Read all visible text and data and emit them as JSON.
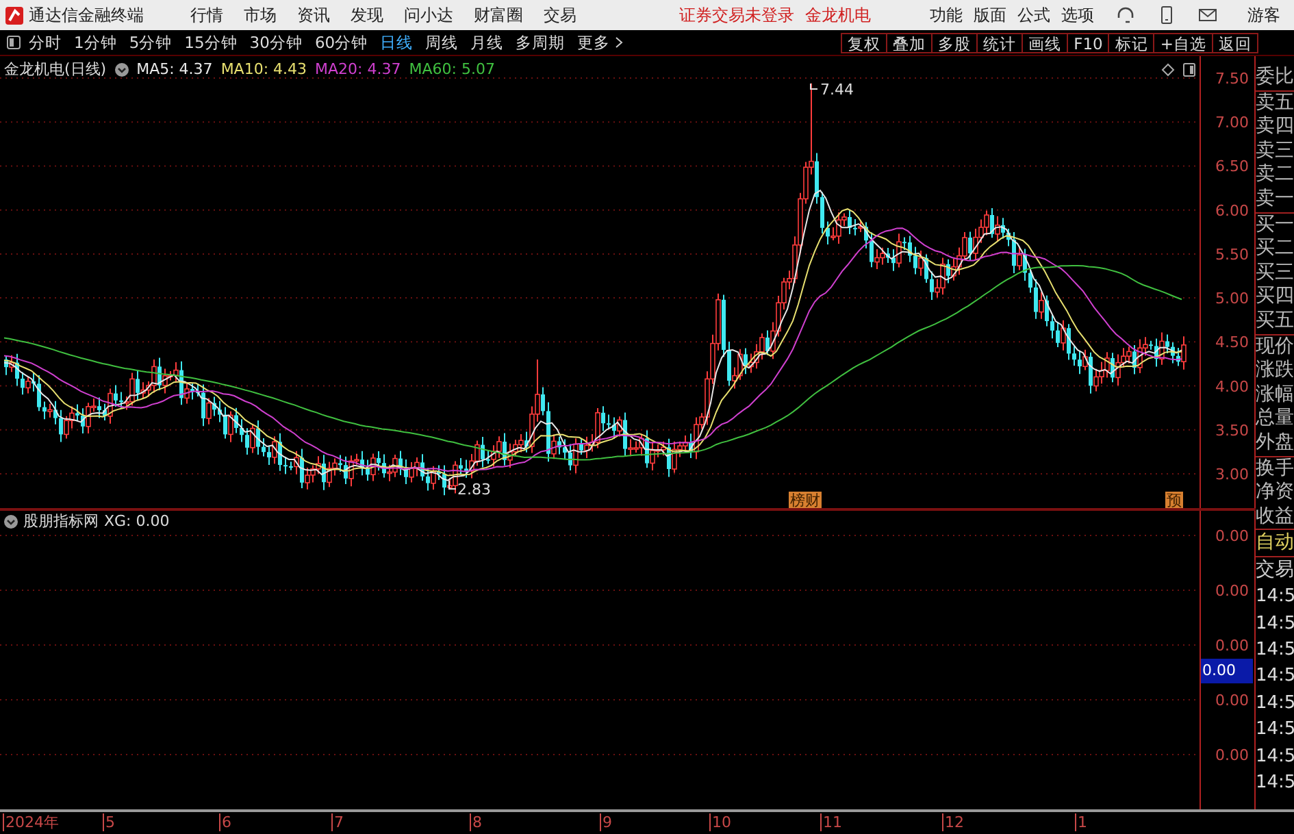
{
  "app": {
    "title": "通达信金融终端"
  },
  "menu": [
    "行情",
    "市场",
    "资讯",
    "发现",
    "问小达",
    "财富圈",
    "交易"
  ],
  "status": {
    "login": "证券交易未登录",
    "stock": "金龙机电"
  },
  "top_actions": [
    "功能",
    "版面",
    "公式",
    "选项"
  ],
  "user": "游客",
  "periods": [
    {
      "label": "分时",
      "selected": false
    },
    {
      "label": "1分钟",
      "selected": false
    },
    {
      "label": "5分钟",
      "selected": false
    },
    {
      "label": "15分钟",
      "selected": false
    },
    {
      "label": "30分钟",
      "selected": false
    },
    {
      "label": "60分钟",
      "selected": false
    },
    {
      "label": "日线",
      "selected": true
    },
    {
      "label": "周线",
      "selected": false
    },
    {
      "label": "月线",
      "selected": false
    },
    {
      "label": "多周期",
      "selected": false
    },
    {
      "label": "更多",
      "selected": false
    }
  ],
  "tools": [
    "复权",
    "叠加",
    "多股",
    "统计",
    "画线",
    "F10",
    "标记",
    "+自选",
    "返回"
  ],
  "chart": {
    "title": "金龙机电(日线)",
    "ma": [
      {
        "label": "MA5: 4.37",
        "color": "#e8e8e8"
      },
      {
        "label": "MA10: 4.43",
        "color": "#e8e070"
      },
      {
        "label": "MA20: 4.37",
        "color": "#d040d0"
      },
      {
        "label": "MA60: 5.07",
        "color": "#40c040"
      }
    ],
    "price_labels": [
      "7.50",
      "7.00",
      "6.50",
      "6.00",
      "5.50",
      "5.00",
      "4.50",
      "4.00",
      "3.50",
      "3.00"
    ],
    "high_label": "7.44",
    "low_label": "2.83",
    "badges": [
      {
        "text": "榜财"
      },
      {
        "text": "预"
      }
    ]
  },
  "indicator": {
    "title": "股朋指标网",
    "reading": "XG: 0.00",
    "axis_labels": [
      "0.00",
      "0.00",
      "0.00",
      "0.00",
      "0.00"
    ],
    "cursor_value": "0.00"
  },
  "side_panel": {
    "groups": [
      [
        "委比"
      ],
      [
        "卖五",
        "卖四",
        "卖三",
        "卖二",
        "卖一"
      ],
      [
        "买一",
        "买二",
        "买三",
        "买四",
        "买五"
      ],
      [
        "现价",
        "涨跌",
        "涨幅",
        "总量",
        "外盘"
      ],
      [
        "换手",
        "净资",
        "收益"
      ]
    ],
    "mode": "自动",
    "trades_title": "交易",
    "times": [
      "14:5",
      "14:5",
      "14:5",
      "14:5",
      "14:5",
      "14:5",
      "14:5",
      "14:5"
    ]
  },
  "time_axis": [
    "2024年",
    "5",
    "6",
    "7",
    "8",
    "9",
    "10",
    "11",
    "12",
    "1"
  ]
}
